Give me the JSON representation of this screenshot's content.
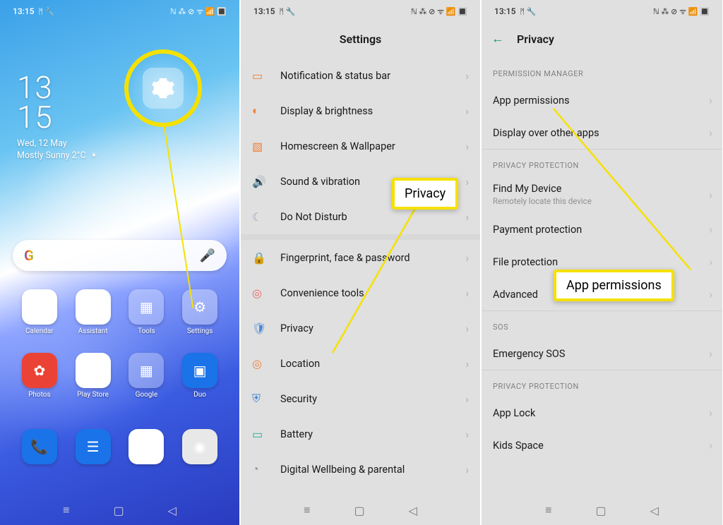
{
  "status": {
    "time": "13:15",
    "icons_left": "ᛗ 🔧",
    "icons_right": "ℕ ⁂ ⊘ ᯤ 📶 🔳"
  },
  "home": {
    "clock_h": "13",
    "clock_m": "15",
    "date": "Wed, 12 May",
    "weather_text": "Mostly Sunny 2°C",
    "weather_icon": "☀",
    "apps": {
      "row1": [
        {
          "label": "Calendar"
        },
        {
          "label": "Assistant"
        },
        {
          "label": "Tools"
        },
        {
          "label": "Settings"
        }
      ],
      "row2": [
        {
          "label": "Photos"
        },
        {
          "label": "Play Store"
        },
        {
          "label": "Google"
        },
        {
          "label": "Duo"
        }
      ]
    }
  },
  "settings": {
    "title": "Settings",
    "items": [
      {
        "label": "Notification & status bar"
      },
      {
        "label": "Display & brightness"
      },
      {
        "label": "Homescreen & Wallpaper"
      },
      {
        "label": "Sound & vibration"
      },
      {
        "label": "Do Not Disturb"
      },
      {
        "label": "Fingerprint, face & password"
      },
      {
        "label": "Convenience tools"
      },
      {
        "label": "Privacy"
      },
      {
        "label": "Location"
      },
      {
        "label": "Security"
      },
      {
        "label": "Battery"
      },
      {
        "label": "Digital Wellbeing & parental"
      }
    ]
  },
  "privacy": {
    "title": "Privacy",
    "sections": {
      "s1_hdr": "Permission Manager",
      "s1": [
        {
          "label": "App permissions"
        },
        {
          "label": "Display over other apps"
        }
      ],
      "s2_hdr": "Privacy Protection",
      "s2": [
        {
          "label": "Find My Device",
          "sub": "Remotely locate this device"
        },
        {
          "label": "Payment protection"
        },
        {
          "label": "File protection"
        },
        {
          "label": "Advanced"
        }
      ],
      "s3_hdr": "SOS",
      "s3": [
        {
          "label": "Emergency SOS"
        }
      ],
      "s4_hdr": "Privacy Protection",
      "s4": [
        {
          "label": "App Lock"
        },
        {
          "label": "Kids Space"
        }
      ]
    }
  },
  "callouts": {
    "privacy": "Privacy",
    "apppermissions": "App permissions"
  }
}
